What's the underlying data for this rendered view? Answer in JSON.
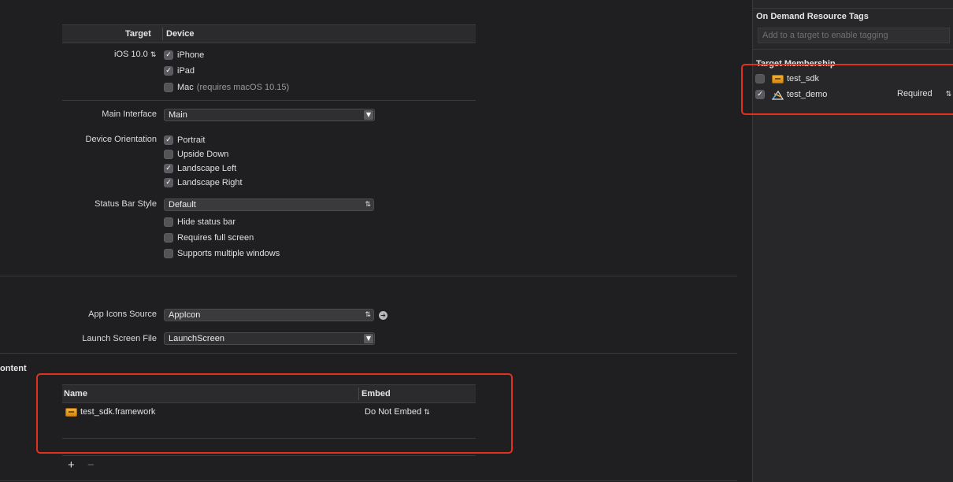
{
  "deployment": {
    "header_target": "Target",
    "header_device": "Device",
    "ios_version": "iOS 10.0",
    "devices": [
      {
        "label": "iPhone",
        "checked": true,
        "note": ""
      },
      {
        "label": "iPad",
        "checked": true,
        "note": ""
      },
      {
        "label": "Mac",
        "checked": false,
        "note": "(requires macOS 10.15)"
      }
    ]
  },
  "main_interface": {
    "label": "Main Interface",
    "value": "Main"
  },
  "device_orientation": {
    "label": "Device Orientation",
    "options": [
      {
        "label": "Portrait",
        "checked": true
      },
      {
        "label": "Upside Down",
        "checked": false
      },
      {
        "label": "Landscape Left",
        "checked": true
      },
      {
        "label": "Landscape Right",
        "checked": true
      }
    ]
  },
  "status_bar": {
    "label": "Status Bar Style",
    "value": "Default",
    "options": [
      {
        "label": "Hide status bar",
        "checked": false
      },
      {
        "label": "Requires full screen",
        "checked": false
      },
      {
        "label": "Supports multiple windows",
        "checked": false
      }
    ]
  },
  "app_icons": {
    "label": "App Icons Source",
    "value": "AppIcon"
  },
  "launch_screen": {
    "label": "Launch Screen File",
    "value": "LaunchScreen"
  },
  "embedded": {
    "section_title": "ontent",
    "header_name": "Name",
    "header_embed": "Embed",
    "rows": [
      {
        "name": "test_sdk.framework",
        "embed": "Do Not Embed"
      }
    ],
    "add_symbol": "+",
    "remove_symbol": "−"
  },
  "inspector": {
    "on_demand_title": "On Demand Resource Tags",
    "tag_placeholder": "Add to a target to enable tagging",
    "membership_title": "Target Membership",
    "targets": [
      {
        "name": "test_sdk",
        "checked": false,
        "icon": "framework-icon",
        "mode": ""
      },
      {
        "name": "test_demo",
        "checked": true,
        "icon": "app-icon",
        "mode": "Required"
      }
    ]
  },
  "colors": {
    "highlight": "#e2321f",
    "background": "#1f1f21",
    "inspector_bg": "#27272a"
  }
}
